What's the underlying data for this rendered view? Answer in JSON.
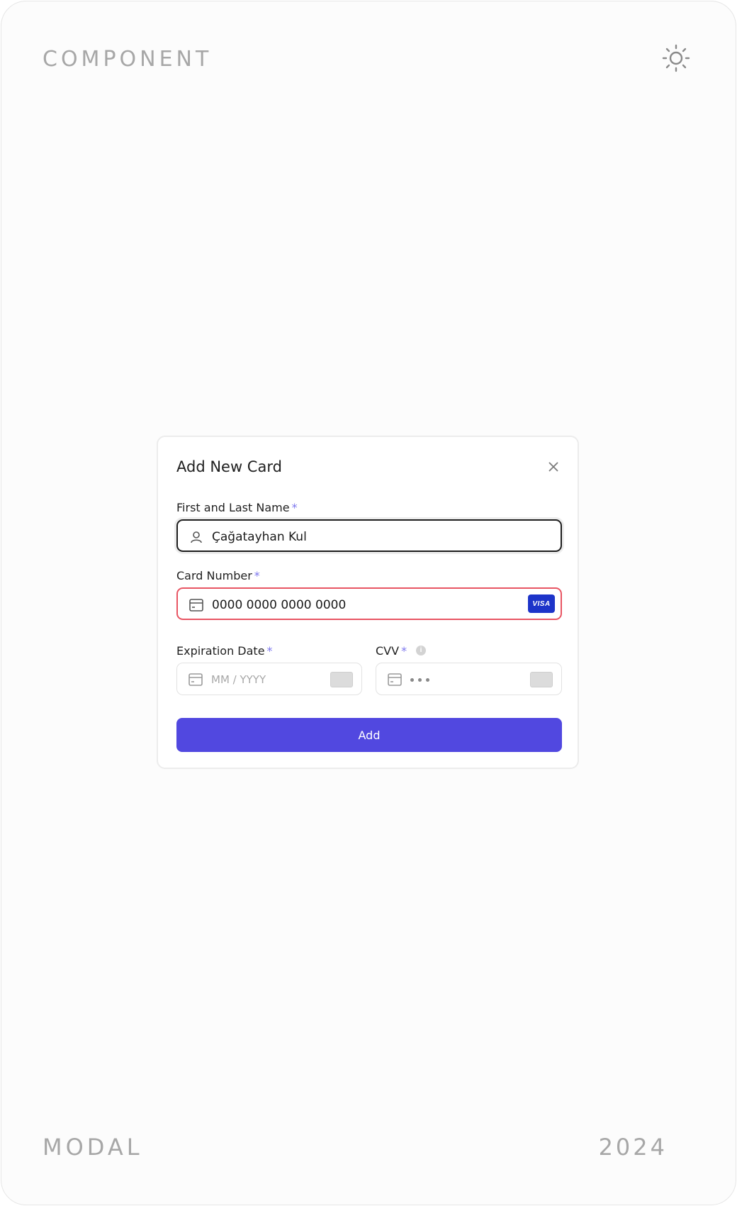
{
  "corners": {
    "top_left": "COMPONENT",
    "bottom_left": "MODAL",
    "bottom_right": "2024"
  },
  "icons": {
    "theme_toggle": "sun-icon",
    "close": "close-icon",
    "name_field": "user-icon",
    "card_field": "credit-card-icon",
    "exp_field": "credit-card-icon",
    "cvv_field": "credit-card-icon",
    "cvv_info": "info-icon"
  },
  "modal": {
    "title": "Add New Card",
    "name": {
      "label": "First and Last Name",
      "required": "*",
      "value": "Çağatayhan Kul"
    },
    "card_number": {
      "label": "Card Number",
      "required": "*",
      "value": "0000 0000 0000 0000",
      "brand": "VISA"
    },
    "expiration": {
      "label": "Expiration Date",
      "required": "*",
      "placeholder": "MM / YYYY"
    },
    "cvv": {
      "label": "CVV",
      "required": "*"
    },
    "add_label": "Add"
  },
  "colors": {
    "accent": "#5148e0",
    "error_border": "#e85563",
    "visa": "#1d34c9"
  }
}
